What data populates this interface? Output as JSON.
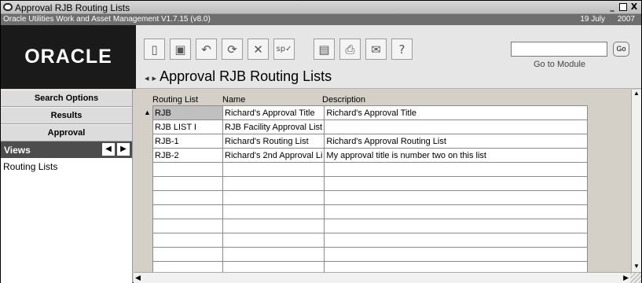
{
  "window": {
    "title": "Approval RJB Routing Lists",
    "app_name": "Oracle Utilities Work and Asset Management V1.7.15 (v8.0)",
    "date": "19 July",
    "year": "2007",
    "controls": {
      "minimize": "_",
      "restore": "□",
      "close": "X"
    }
  },
  "header": {
    "logo": "ORACLE",
    "page_title": "Approval RJB Routing Lists",
    "nav_prev": "◂",
    "nav_next": "▸",
    "goto_label": "Go to Module",
    "go_button": "Go",
    "toolbar": [
      {
        "name": "new-icon",
        "glyph": "▯"
      },
      {
        "name": "save-icon",
        "glyph": "▣"
      },
      {
        "name": "undo-icon",
        "glyph": "↶"
      },
      {
        "name": "refresh-icon",
        "glyph": "⟳"
      },
      {
        "name": "delete-icon",
        "glyph": "✕"
      },
      {
        "name": "spellcheck-icon",
        "glyph": "sp✓"
      },
      {
        "name": "report-icon",
        "glyph": "▤"
      },
      {
        "name": "print-icon",
        "glyph": "⎙"
      },
      {
        "name": "mail-icon",
        "glyph": "✉"
      },
      {
        "name": "help-icon",
        "glyph": "?"
      }
    ]
  },
  "left_panel": {
    "search_options": "Search Options",
    "results": "Results",
    "approval": "Approval",
    "views_label": "Views",
    "view_item": "Routing Lists"
  },
  "grid": {
    "columns": [
      "Routing List",
      "Name",
      "Description"
    ],
    "rows": [
      [
        "RJB",
        "Richard's Approval Title",
        "Richard's Approval Title"
      ],
      [
        "RJB LIST I",
        "RJB Facility Approval List",
        ""
      ],
      [
        "RJB-1",
        "Richard's Routing List",
        "Richard's Approval Routing List"
      ],
      [
        "RJB-2",
        "Richard's 2nd Approval Li",
        "My approval title is number two on this list"
      ],
      [
        "",
        "",
        ""
      ],
      [
        "",
        "",
        ""
      ],
      [
        "",
        "",
        ""
      ],
      [
        "",
        "",
        ""
      ],
      [
        "",
        "",
        ""
      ],
      [
        "",
        "",
        ""
      ],
      [
        "",
        "",
        ""
      ],
      [
        "",
        "",
        ""
      ]
    ]
  }
}
